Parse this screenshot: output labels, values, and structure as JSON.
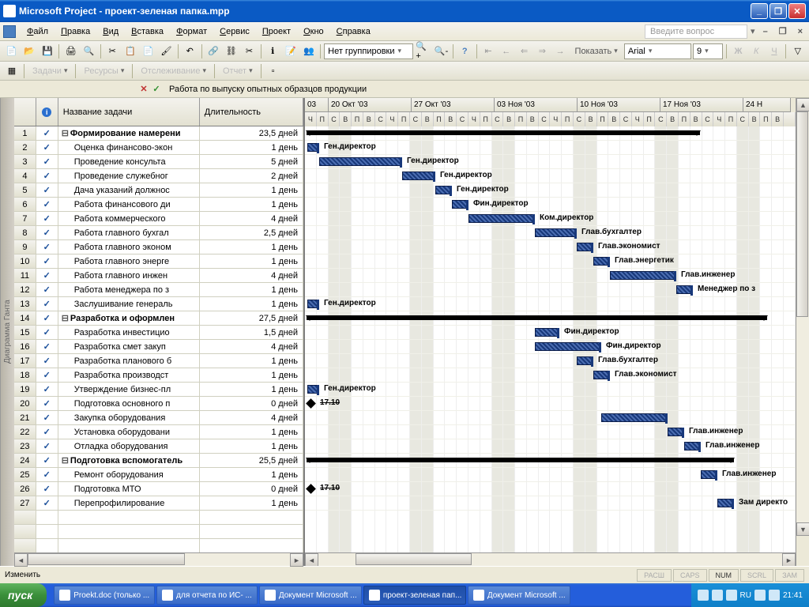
{
  "window": {
    "title": "Microsoft Project - проект-зеленая папка.mpp"
  },
  "menu": {
    "items": [
      "Файл",
      "Правка",
      "Вид",
      "Вставка",
      "Формат",
      "Сервис",
      "Проект",
      "Окно",
      "Справка"
    ],
    "question": "Введите вопрос"
  },
  "toolbar1": {
    "grouping": "Нет группировки",
    "show": "Показать",
    "font": "Arial",
    "size": "9"
  },
  "toolbar2": {
    "tasks": "Задачи",
    "resources": "Ресурсы",
    "tracking": "Отслеживание",
    "report": "Отчет"
  },
  "formula_bar": {
    "text": "Работа по выпуску опытных образцов продукции"
  },
  "columns": {
    "indicator": "",
    "name": "Название задачи",
    "duration": "Длительность"
  },
  "timeline": {
    "weeks": [
      "03",
      "20 Окт '03",
      "27 Окт '03",
      "03 Ноя '03",
      "10 Ноя '03",
      "17 Ноя '03",
      "24 Н"
    ],
    "day_labels": [
      "Ч",
      "П",
      "С",
      "В",
      "П",
      "В",
      "С",
      "Ч",
      "П",
      "С",
      "В",
      "П",
      "В",
      "С",
      "Ч",
      "П",
      "С",
      "В",
      "П",
      "В",
      "С",
      "Ч",
      "П",
      "С",
      "В",
      "П",
      "В",
      "С",
      "Ч",
      "П",
      "С",
      "В",
      "П",
      "В",
      "С",
      "Ч",
      "П",
      "С",
      "В",
      "П",
      "В"
    ]
  },
  "tasks": [
    {
      "id": "1",
      "name": "Формирование намерени",
      "duration": "23,5 дней",
      "summary": true,
      "indent": 0,
      "start": 2,
      "end": 500,
      "done": true
    },
    {
      "id": "2",
      "name": "Оценка финансово-экон",
      "duration": "1 день",
      "indent": 1,
      "start": 3,
      "end": 18,
      "label": "Ген.директор",
      "done": true
    },
    {
      "id": "3",
      "name": "Проведение консульта",
      "duration": "5 дней",
      "indent": 1,
      "start": 18,
      "end": 123,
      "label": "Ген.директор",
      "done": true
    },
    {
      "id": "4",
      "name": "Проведение служебног",
      "duration": "2 дней",
      "indent": 1,
      "start": 123,
      "end": 165,
      "label": "Ген.директор",
      "done": true
    },
    {
      "id": "5",
      "name": "Дача указаний должнос",
      "duration": "1 день",
      "indent": 1,
      "start": 165,
      "end": 186,
      "label": "Ген.директор",
      "done": true
    },
    {
      "id": "6",
      "name": "Работа финансового ди",
      "duration": "1 день",
      "indent": 1,
      "start": 186,
      "end": 207,
      "label": "Фин.директор",
      "done": true
    },
    {
      "id": "7",
      "name": "Работа коммерческого",
      "duration": "4 дней",
      "indent": 1,
      "start": 207,
      "end": 291,
      "label": "Ком.директор",
      "done": true
    },
    {
      "id": "8",
      "name": "Работа главного бухгал",
      "duration": "2,5 дней",
      "indent": 1,
      "start": 291,
      "end": 344,
      "label": "Глав.бухгалтер",
      "done": true
    },
    {
      "id": "9",
      "name": "Работа главного эконом",
      "duration": "1 день",
      "indent": 1,
      "start": 344,
      "end": 365,
      "label": "Глав.экономист",
      "done": true
    },
    {
      "id": "10",
      "name": "Работа главного энерге",
      "duration": "1 день",
      "indent": 1,
      "start": 365,
      "end": 386,
      "label": "Глав.энергетик",
      "done": true
    },
    {
      "id": "11",
      "name": "Работа главного инжен",
      "duration": "4 дней",
      "indent": 1,
      "start": 386,
      "end": 470,
      "label": "Глав.инженер",
      "done": true
    },
    {
      "id": "12",
      "name": "Работа менеджера по з",
      "duration": "1 день",
      "indent": 1,
      "start": 470,
      "end": 491,
      "label": "Менеджер по з",
      "done": true
    },
    {
      "id": "13",
      "name": "Заслушивание генераль",
      "duration": "1 день",
      "indent": 1,
      "start": 3,
      "end": 18,
      "label": "Ген.директор",
      "done": true
    },
    {
      "id": "14",
      "name": "Разработка и оформлен",
      "duration": "27,5 дней",
      "summary": true,
      "indent": 0,
      "start": 2,
      "end": 585,
      "done": true
    },
    {
      "id": "15",
      "name": "Разработка инвестицио",
      "duration": "1,5 дней",
      "indent": 1,
      "start": 291,
      "end": 322,
      "label": "Фин.директор",
      "done": true
    },
    {
      "id": "16",
      "name": "Разработка смет закуп",
      "duration": "4 дней",
      "indent": 1,
      "start": 291,
      "end": 375,
      "label": "Фин.директор",
      "done": true
    },
    {
      "id": "17",
      "name": "Разработка планового б",
      "duration": "1 день",
      "indent": 1,
      "start": 344,
      "end": 365,
      "label": "Глав.бухгалтер",
      "done": true
    },
    {
      "id": "18",
      "name": "Разработка производст",
      "duration": "1 день",
      "indent": 1,
      "start": 365,
      "end": 386,
      "label": "Глав.экономист",
      "done": true
    },
    {
      "id": "19",
      "name": "Утверждение бизнес-пл",
      "duration": "1 день",
      "indent": 1,
      "start": 3,
      "end": 18,
      "label": "Ген.директор",
      "done": true
    },
    {
      "id": "20",
      "name": "Подготовка основного п",
      "duration": "0 дней",
      "indent": 1,
      "milestone": true,
      "start": 3,
      "ms_label": "17.10",
      "done": true
    },
    {
      "id": "21",
      "name": "Закупка оборудования",
      "duration": "4 дней",
      "indent": 1,
      "start": 375,
      "end": 459,
      "done": true
    },
    {
      "id": "22",
      "name": "Установка оборудовани",
      "duration": "1 день",
      "indent": 1,
      "start": 459,
      "end": 480,
      "label": "Глав.инженер",
      "done": true
    },
    {
      "id": "23",
      "name": "Отладка оборудования",
      "duration": "1 день",
      "indent": 1,
      "start": 480,
      "end": 501,
      "label": "Глав.инженер",
      "done": true
    },
    {
      "id": "24",
      "name": "Подготовка вспомогатель",
      "duration": "25,5 дней",
      "summary": true,
      "indent": 0,
      "start": 2,
      "end": 543,
      "done": true
    },
    {
      "id": "25",
      "name": "Ремонт оборудования",
      "duration": "1 день",
      "indent": 1,
      "start": 501,
      "end": 522,
      "label": "Глав.инженер",
      "done": true
    },
    {
      "id": "26",
      "name": "Подготовка МТО",
      "duration": "0 дней",
      "indent": 1,
      "milestone": true,
      "start": 3,
      "ms_label": "17.10",
      "done": true
    },
    {
      "id": "27",
      "name": "Перепрофилирование",
      "duration": "1 день",
      "indent": 1,
      "start": 522,
      "end": 543,
      "label": "Зам директо",
      "done": true
    }
  ],
  "vtab_label": "Диаграмма Ганта",
  "status": {
    "edit": "Изменить",
    "indicators": [
      "РАСШ",
      "CAPS",
      "NUM",
      "SCRL",
      "ЗАМ"
    ],
    "active_ind": "NUM"
  },
  "taskbar": {
    "start": "пуск",
    "items": [
      "Proekt.doc (только ...",
      "для отчета по ИС- ...",
      "Документ Microsoft ...",
      "проект-зеленая пап...",
      "Документ Microsoft ..."
    ],
    "active_index": 3,
    "lang": "RU",
    "time": "21:41"
  }
}
